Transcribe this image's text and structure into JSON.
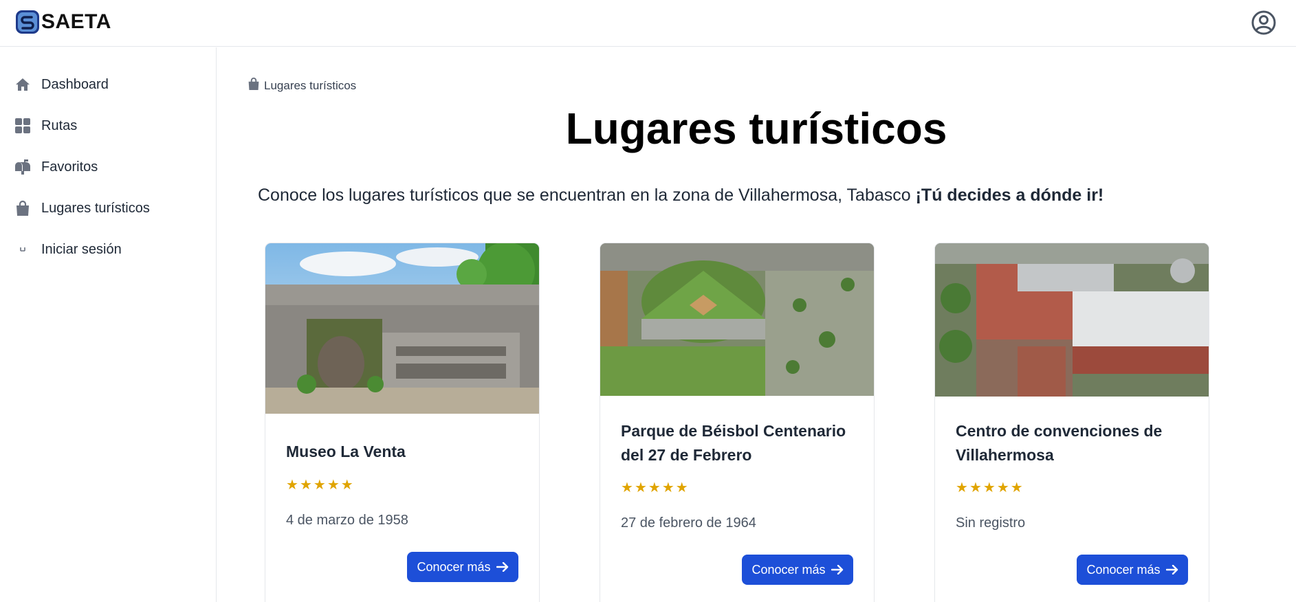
{
  "header": {
    "brand_name": "SAETA",
    "logo_icon": "saeta-logo-icon",
    "user_icon": "user-circle-icon"
  },
  "sidebar": {
    "items": [
      {
        "label": "Dashboard",
        "icon": "home-icon"
      },
      {
        "label": "Rutas",
        "icon": "grid-icon"
      },
      {
        "label": "Favoritos",
        "icon": "mailbox-icon"
      },
      {
        "label": "Lugares turísticos",
        "icon": "shopping-bag-icon"
      },
      {
        "label": "Iniciar sesión",
        "icon": "login-icon"
      }
    ]
  },
  "breadcrumb": {
    "label": "Lugares turísticos",
    "icon": "shopping-bag-icon"
  },
  "main": {
    "title": "Lugares turísticos",
    "intro_text": "Conoce los lugares turísticos que se encuentran en la zona de Villahermosa, Tabasco ",
    "intro_emphasis": "¡Tú decides a dónde ir!"
  },
  "cards": [
    {
      "title": "Museo La Venta",
      "rating": 5,
      "date": "4 de marzo de 1958",
      "button_label": "Conocer más"
    },
    {
      "title": "Parque de Béisbol Centenario del 27 de Febrero",
      "rating": 5,
      "date": "27 de febrero de 1964",
      "button_label": "Conocer más"
    },
    {
      "title": "Centro de convenciones de Villahermosa",
      "rating": 5,
      "date": "Sin registro",
      "button_label": "Conocer más"
    }
  ],
  "colors": {
    "accent": "#1d4fd8",
    "star": "#e0a400",
    "border": "#e5e7eb",
    "icon_gray": "#6b7280"
  }
}
